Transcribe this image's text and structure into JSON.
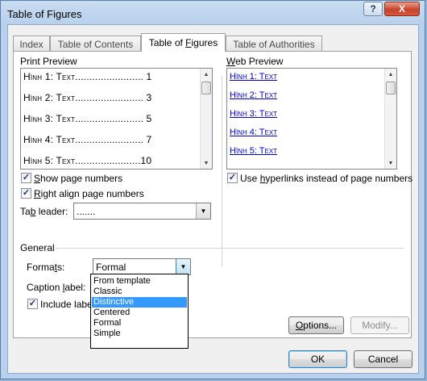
{
  "window": {
    "title": "Table of Figures",
    "help_label": "?",
    "close_label": "X"
  },
  "tabs": [
    {
      "label": "Index",
      "active": false
    },
    {
      "label": "Table of Contents",
      "active": false
    },
    {
      "label": "Table of Figures",
      "active": true
    },
    {
      "label": "Table of Authorities",
      "active": false
    }
  ],
  "print_preview": {
    "label": "Print Preview",
    "rows": [
      "Hình 1: Text........................ 1",
      "Hình 2: Text........................ 3",
      "Hình 3: Text........................ 5",
      "Hình 4: Text........................ 7",
      "Hình 5: Text.......................10"
    ]
  },
  "web_preview": {
    "label": "Web Preview",
    "rows": [
      "Hình 1: Text",
      "Hình 2: Text",
      "Hình 3: Text",
      "Hình 4: Text",
      "Hình 5: Text"
    ]
  },
  "options": {
    "show_page_numbers": "Show page numbers",
    "right_align": "Right align page numbers",
    "tab_leader_label": "Tab leader:",
    "tab_leader_value": ".......",
    "use_hyperlinks": "Use hyperlinks instead of page numbers"
  },
  "general": {
    "label": "General",
    "formats_label": "Formats:",
    "formats_value": "Formal",
    "caption_label": "Caption label:",
    "include_label": "Include labe",
    "format_options": [
      "From template",
      "Classic",
      "Distinctive",
      "Centered",
      "Formal",
      "Simple"
    ],
    "selected_option": "Distinctive"
  },
  "buttons": {
    "options": "Options...",
    "modify": "Modify...",
    "ok": "OK",
    "cancel": "Cancel"
  },
  "checked_mark": "✓",
  "icons": {
    "up": "▲",
    "down": "▼",
    "combo": "▼"
  }
}
